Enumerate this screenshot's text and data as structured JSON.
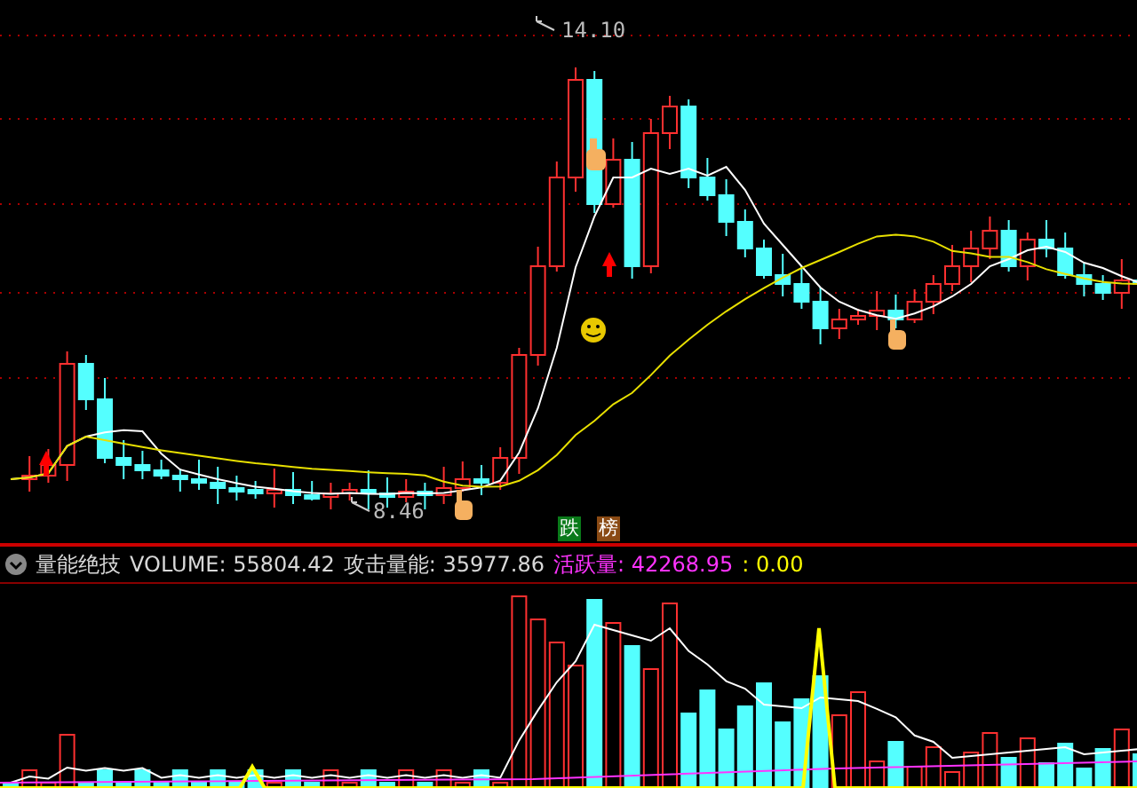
{
  "main_chart": {
    "high_label": "14.10",
    "low_label": "8.46",
    "badges": [
      {
        "text": "跌",
        "color": "#0a7a1a"
      },
      {
        "text": "榜",
        "color": "#8a4a14"
      }
    ]
  },
  "indicator": {
    "name": "量能绝技",
    "values": [
      {
        "text": "VOLUME: 55804.42",
        "color": "#d8d8d8"
      },
      {
        "text": "攻击量能: 35977.86",
        "color": "#d8d8d8"
      },
      {
        "text": "活跃量: 42268.95",
        "color": "#ff33ff"
      },
      {
        "text": ": 0.00",
        "color": "#ffff00"
      }
    ]
  }
}
